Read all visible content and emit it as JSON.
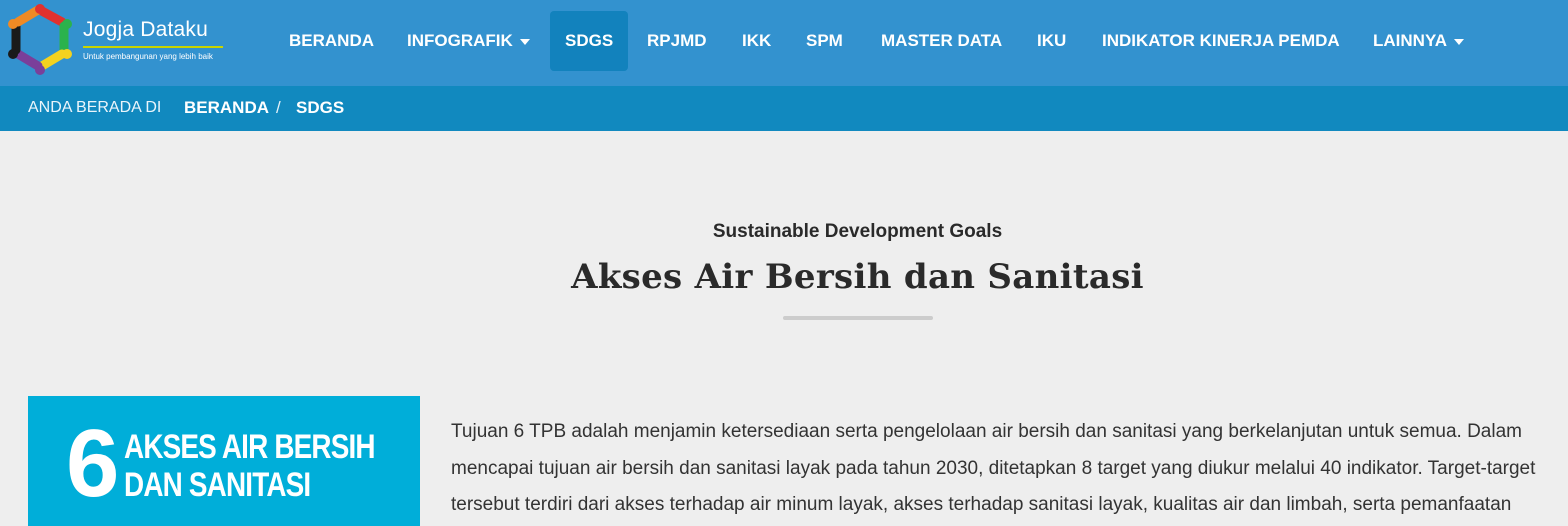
{
  "brand": {
    "name": "Jogja Dataku",
    "tagline": "Untuk pembangunan yang lebih baik",
    "logo_icon": "jogja-dataku-logo"
  },
  "nav": {
    "items": [
      {
        "label": "BERANDA",
        "dropdown": false,
        "active": false
      },
      {
        "label": "INFOGRAFIK",
        "dropdown": true,
        "active": false
      },
      {
        "label": "SDGS",
        "dropdown": false,
        "active": true
      },
      {
        "label": "RPJMD",
        "dropdown": false,
        "active": false
      },
      {
        "label": "IKK",
        "dropdown": false,
        "active": false
      },
      {
        "label": "SPM",
        "dropdown": false,
        "active": false
      },
      {
        "label": "MASTER DATA",
        "dropdown": false,
        "active": false
      },
      {
        "label": "IKU",
        "dropdown": false,
        "active": false
      },
      {
        "label": "INDIKATOR KINERJA PEMDA",
        "dropdown": false,
        "active": false
      },
      {
        "label": "LAINNYA",
        "dropdown": true,
        "active": false
      }
    ]
  },
  "breadcrumb": {
    "prefix": "ANDA BERADA DI",
    "items": [
      "BERANDA",
      "SDGS"
    ],
    "separator": "/"
  },
  "header": {
    "subtitle": "Sustainable Development Goals",
    "title": "Akses Air Bersih dan Sanitasi"
  },
  "goal_tile": {
    "number": "6",
    "line1": "AKSES AIR BERSIH",
    "line2": "DAN SANITASI",
    "color": "#00aed9"
  },
  "description": "Tujuan 6 TPB adalah menjamin ketersediaan serta pengelolaan air bersih dan sanitasi yang berkelanjutan untuk semua. Dalam mencapai tujuan air bersih dan sanitasi layak pada tahun 2030, ditetapkan 8 target yang diukur melalui 40 indikator. Target-target tersebut terdiri dari akses terhadap air minum layak, akses terhadap sanitasi layak, kualitas air dan limbah, serta pemanfaatan",
  "colors": {
    "navbar": "#3392cf",
    "breadcrumb_bar": "#1189bf",
    "active_nav": "#1282bd",
    "page_background": "#eeeeee"
  }
}
